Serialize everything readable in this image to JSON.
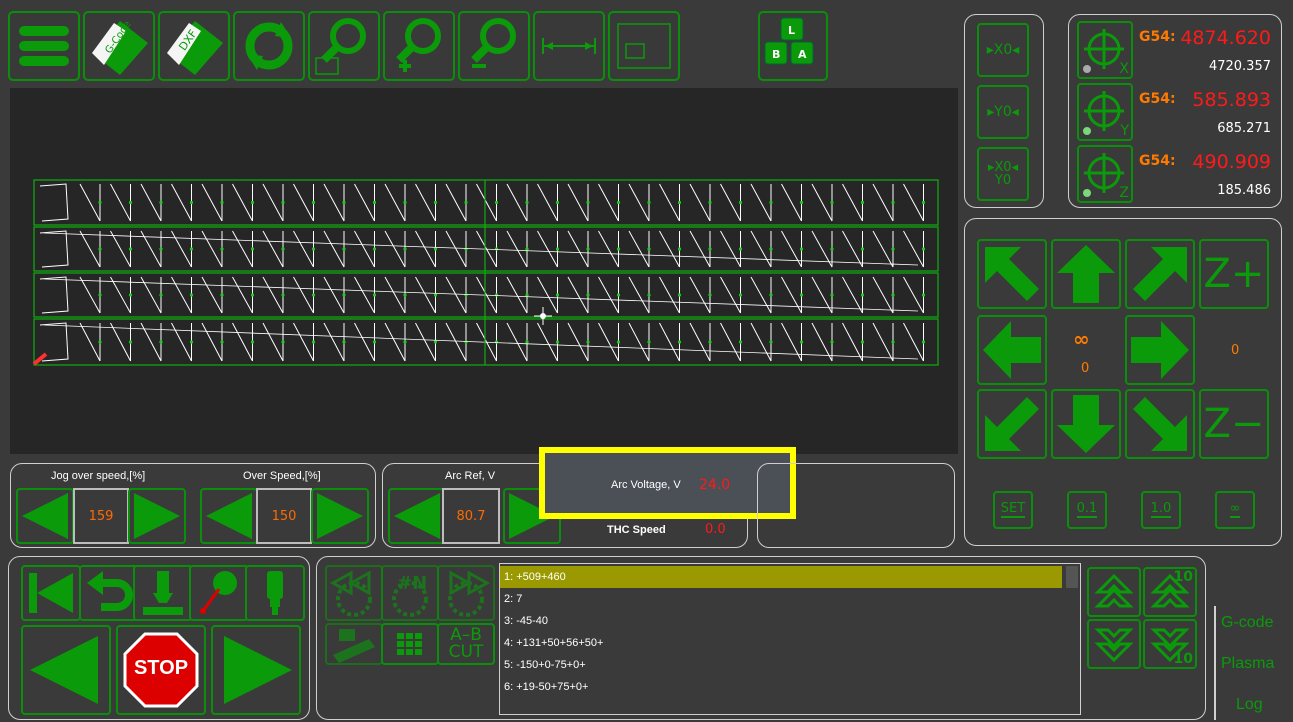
{
  "toolbar": {
    "buttons": [
      {
        "name": "menu-button",
        "icon": "hamburger-menu-icon"
      },
      {
        "name": "open-gcode-button",
        "icon": "gcode-file-icon",
        "label": "G-Code"
      },
      {
        "name": "open-dxf-button",
        "icon": "dxf-file-icon",
        "label": "DXF"
      },
      {
        "name": "refresh-button",
        "icon": "refresh-icon"
      },
      {
        "name": "zoom-window-button",
        "icon": "zoom-window-icon"
      },
      {
        "name": "zoom-in-button",
        "icon": "zoom-in-icon"
      },
      {
        "name": "zoom-out-button",
        "icon": "zoom-out-icon"
      },
      {
        "name": "fit-width-button",
        "icon": "fit-width-icon"
      },
      {
        "name": "fit-screen-button",
        "icon": "fit-screen-icon"
      }
    ],
    "keys_button": {
      "keys": [
        "L",
        "B",
        "A"
      ]
    }
  },
  "zero_buttons": {
    "x0": "X0",
    "y0": "Y0",
    "xy0_line1": "X0",
    "xy0_line2": "Y0"
  },
  "dro": {
    "x": {
      "g54": "G54:",
      "work": "4874.620",
      "machine": "4720.357",
      "axis": "X"
    },
    "y": {
      "g54": "G54:",
      "work": "585.893",
      "machine": "685.271",
      "axis": "Y"
    },
    "z": {
      "g54": "G54:",
      "work": "490.909",
      "machine": "185.486",
      "axis": "Z"
    }
  },
  "jog": {
    "z_plus": "Z+",
    "z_minus": "Z−",
    "infinity": "∞",
    "step_value": "0",
    "z_value": "0",
    "step_buttons": [
      "SET",
      "0.1",
      "1.0",
      "∞"
    ]
  },
  "speed": {
    "jog_over_label": "Jog over speed,[%]",
    "jog_over_value": "159",
    "over_label": "Over Speed,[%]",
    "over_value": "150",
    "arc_ref_label": "Arc Ref, V",
    "arc_ref_value": "80.7"
  },
  "thc": {
    "arc_voltage_label": "Arc Voltage, V",
    "arc_voltage_value": "24.0",
    "thc_speed_label": "THC Speed",
    "thc_speed_value": "0.0"
  },
  "program": {
    "controls": {
      "stop": "STOP",
      "goto_line": "#N",
      "ab_cut_line1": "A–B",
      "ab_cut_line2": "CUT"
    },
    "lines": [
      "1: +509+460",
      "2: 7",
      "3: -45-40",
      "4: +131+50+56+50+",
      "5: -150+0-75+0+",
      "6: +19-50+75+0+"
    ],
    "selected_line": 0,
    "scroll_step": "10"
  },
  "tabs": [
    "G-code",
    "Plasma",
    "Log"
  ],
  "colors": {
    "accent": "#0a9a0a",
    "highlight": "#ffff00",
    "work_coord": "#ff1a1a",
    "g54": "#ff7a00",
    "selected_row": "#9a9a00"
  }
}
